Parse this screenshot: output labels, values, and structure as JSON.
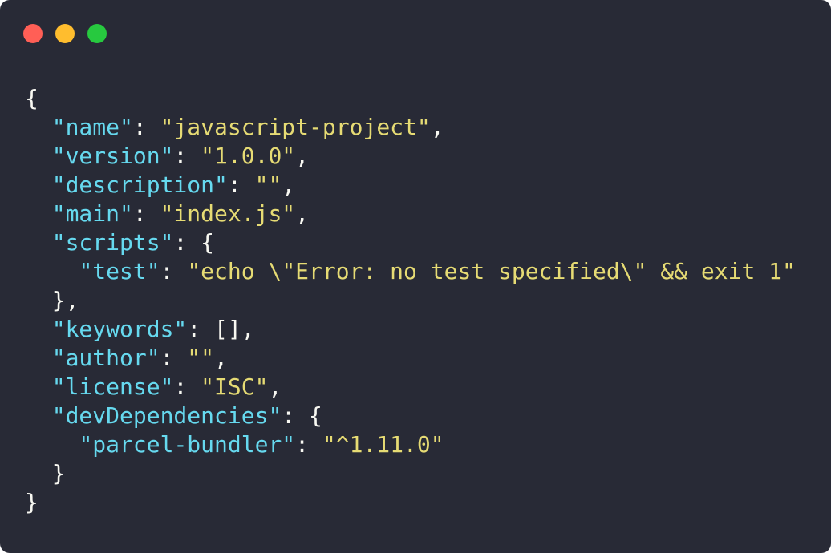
{
  "window": {
    "buttons": [
      {
        "name": "close",
        "color": "#ff5f56"
      },
      {
        "name": "minimize",
        "color": "#ffbd2e"
      },
      {
        "name": "zoom",
        "color": "#27c93f"
      }
    ]
  },
  "colors": {
    "background": "#282a36",
    "key": "#66d9ef",
    "string": "#e6db74",
    "punctuation": "#f8f8f2"
  },
  "code": {
    "lines": [
      [
        {
          "t": "pun",
          "v": "{"
        }
      ],
      [
        {
          "t": "pun",
          "v": "  "
        },
        {
          "t": "key",
          "v": "\"name\""
        },
        {
          "t": "pun",
          "v": ": "
        },
        {
          "t": "str",
          "v": "\"javascript-project\""
        },
        {
          "t": "pun",
          "v": ","
        }
      ],
      [
        {
          "t": "pun",
          "v": "  "
        },
        {
          "t": "key",
          "v": "\"version\""
        },
        {
          "t": "pun",
          "v": ": "
        },
        {
          "t": "str",
          "v": "\"1.0.0\""
        },
        {
          "t": "pun",
          "v": ","
        }
      ],
      [
        {
          "t": "pun",
          "v": "  "
        },
        {
          "t": "key",
          "v": "\"description\""
        },
        {
          "t": "pun",
          "v": ": "
        },
        {
          "t": "str",
          "v": "\"\""
        },
        {
          "t": "pun",
          "v": ","
        }
      ],
      [
        {
          "t": "pun",
          "v": "  "
        },
        {
          "t": "key",
          "v": "\"main\""
        },
        {
          "t": "pun",
          "v": ": "
        },
        {
          "t": "str",
          "v": "\"index.js\""
        },
        {
          "t": "pun",
          "v": ","
        }
      ],
      [
        {
          "t": "pun",
          "v": "  "
        },
        {
          "t": "key",
          "v": "\"scripts\""
        },
        {
          "t": "pun",
          "v": ": {"
        }
      ],
      [
        {
          "t": "pun",
          "v": "    "
        },
        {
          "t": "key",
          "v": "\"test\""
        },
        {
          "t": "pun",
          "v": ": "
        },
        {
          "t": "str",
          "v": "\"echo \\\"Error: no test specified\\\" && exit 1\""
        }
      ],
      [
        {
          "t": "pun",
          "v": "  },"
        }
      ],
      [
        {
          "t": "pun",
          "v": "  "
        },
        {
          "t": "key",
          "v": "\"keywords\""
        },
        {
          "t": "pun",
          "v": ": [],"
        }
      ],
      [
        {
          "t": "pun",
          "v": "  "
        },
        {
          "t": "key",
          "v": "\"author\""
        },
        {
          "t": "pun",
          "v": ": "
        },
        {
          "t": "str",
          "v": "\"\""
        },
        {
          "t": "pun",
          "v": ","
        }
      ],
      [
        {
          "t": "pun",
          "v": "  "
        },
        {
          "t": "key",
          "v": "\"license\""
        },
        {
          "t": "pun",
          "v": ": "
        },
        {
          "t": "str",
          "v": "\"ISC\""
        },
        {
          "t": "pun",
          "v": ","
        }
      ],
      [
        {
          "t": "pun",
          "v": "  "
        },
        {
          "t": "key",
          "v": "\"devDependencies\""
        },
        {
          "t": "pun",
          "v": ": {"
        }
      ],
      [
        {
          "t": "pun",
          "v": "    "
        },
        {
          "t": "key",
          "v": "\"parcel-bundler\""
        },
        {
          "t": "pun",
          "v": ": "
        },
        {
          "t": "str",
          "v": "\"^1.11.0\""
        }
      ],
      [
        {
          "t": "pun",
          "v": "  }"
        }
      ],
      [
        {
          "t": "pun",
          "v": "}"
        }
      ]
    ]
  }
}
